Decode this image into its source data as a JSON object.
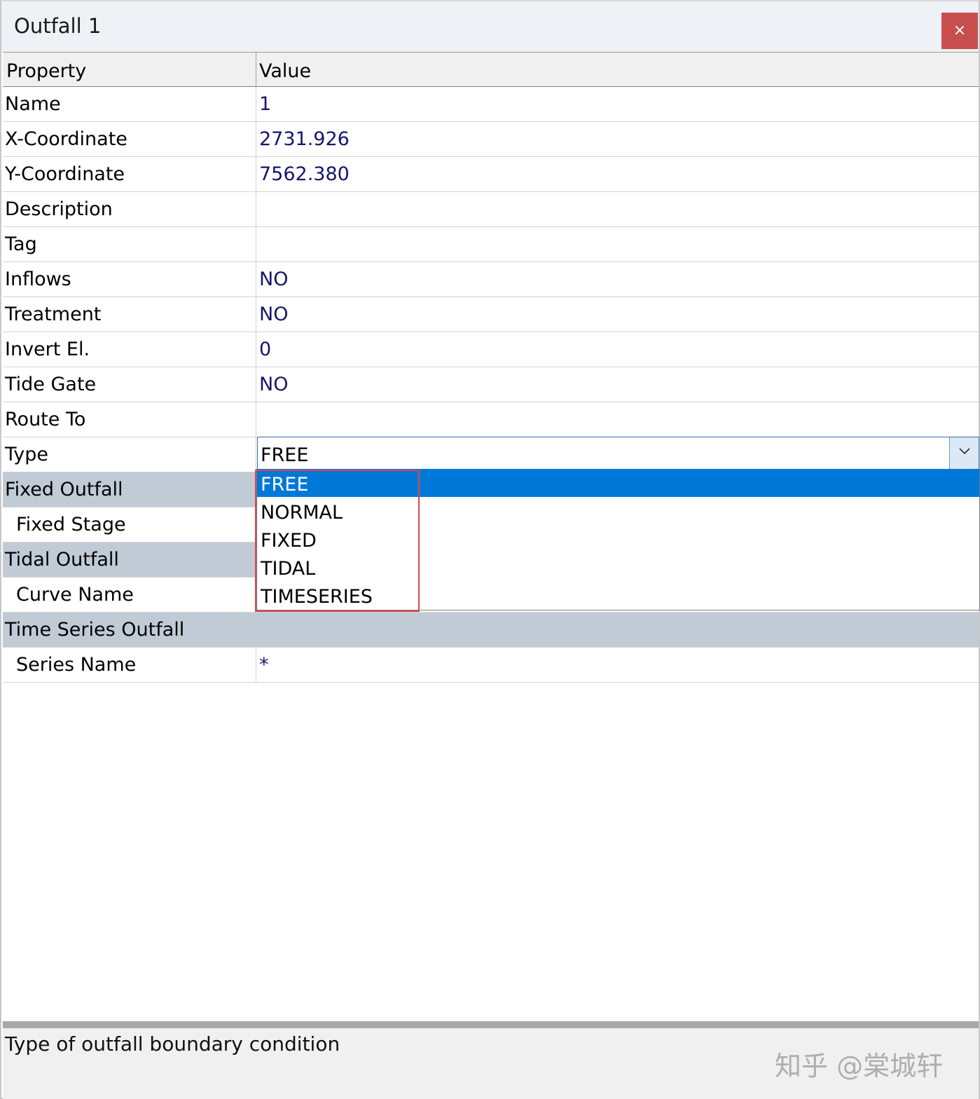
{
  "window": {
    "title": "Outfall 1",
    "close_label": "×"
  },
  "grid": {
    "header": {
      "property": "Property",
      "value": "Value"
    },
    "rows": [
      {
        "property": "Name",
        "value": "1"
      },
      {
        "property": "X-Coordinate",
        "value": "2731.926"
      },
      {
        "property": "Y-Coordinate",
        "value": "7562.380"
      },
      {
        "property": "Description",
        "value": ""
      },
      {
        "property": "Tag",
        "value": ""
      },
      {
        "property": "Inflows",
        "value": "NO"
      },
      {
        "property": "Treatment",
        "value": "NO"
      },
      {
        "property": "Invert El.",
        "value": "0"
      },
      {
        "property": "Tide Gate",
        "value": "NO"
      },
      {
        "property": "Route To",
        "value": ""
      },
      {
        "property": "Type",
        "value": "FREE"
      },
      {
        "property": "Fixed Outfall",
        "value": ""
      },
      {
        "property": "Fixed Stage",
        "value": ""
      },
      {
        "property": "Tidal Outfall",
        "value": ""
      },
      {
        "property": "Curve Name",
        "value": ""
      },
      {
        "property": "Time Series Outfall",
        "value": ""
      },
      {
        "property": "Series Name",
        "value": "*"
      }
    ]
  },
  "type_dropdown": {
    "selected": "FREE",
    "options": [
      "FREE",
      "NORMAL",
      "FIXED",
      "TIDAL",
      "TIMESERIES"
    ]
  },
  "status": {
    "description": "Type of outfall boundary condition"
  },
  "watermark": "知乎 @棠城轩",
  "colors": {
    "category_bg": "#c0cbd6",
    "selection_bg": "#0078d7",
    "value_text": "#16166b",
    "close_bg": "#c94f4f",
    "highlight_border": "#d9454a"
  }
}
